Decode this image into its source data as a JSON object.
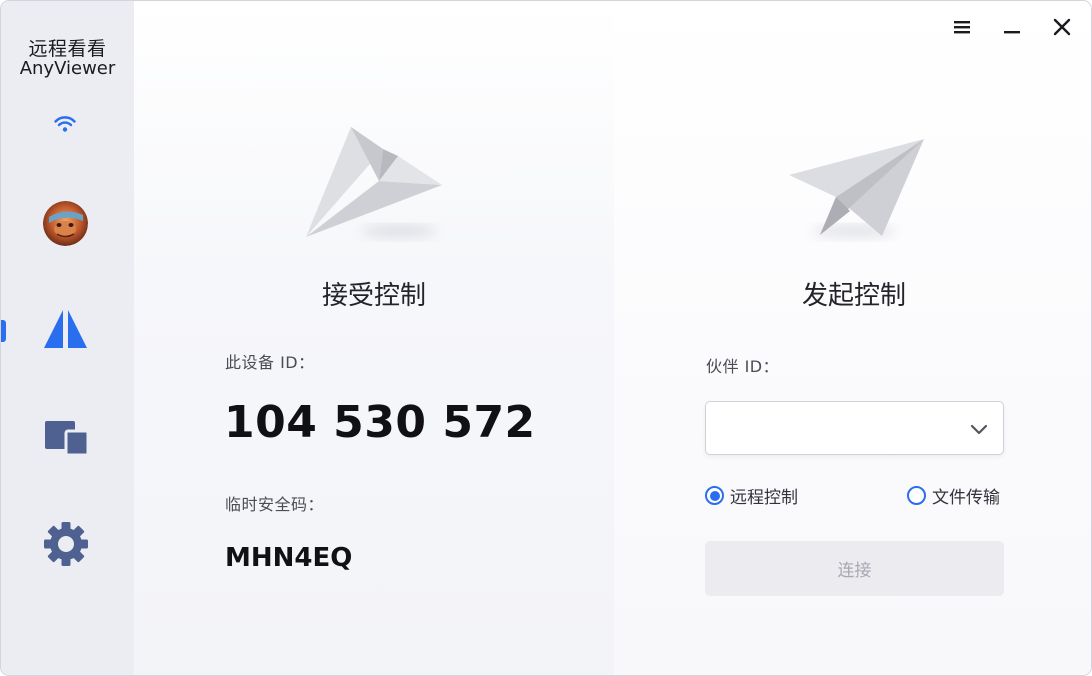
{
  "sidebar": {
    "brand_cn": "远程看看",
    "brand_en": "AnyViewer",
    "icons": [
      "wifi-icon",
      "avatar",
      "remote-control-icon",
      "devices-icon",
      "gear-icon"
    ]
  },
  "window_controls": [
    "menu-icon",
    "minimize-icon",
    "close-icon"
  ],
  "receive": {
    "title": "接受控制",
    "device_id_label": "此设备 ID：",
    "device_id": "104 530 572",
    "security_code_label": "临时安全码：",
    "security_code": "MHN4EQ"
  },
  "initiate": {
    "title": "发起控制",
    "partner_id_label": "伙伴 ID：",
    "partner_id_value": "",
    "partner_id_placeholder": "",
    "radio_remote": "远程控制",
    "radio_file": "文件传输",
    "selected_mode": "远程控制",
    "connect_label": "连接"
  },
  "colors": {
    "accent": "#2a6ef0",
    "sidebar_bg": "#ecedf3",
    "icon_blue": "#2a6ef0",
    "icon_slate": "#4f6191"
  }
}
